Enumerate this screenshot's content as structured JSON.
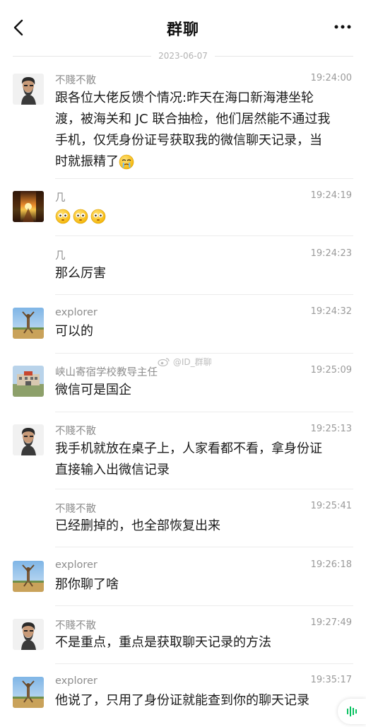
{
  "header": {
    "title": "群聊",
    "back_icon": "chevron-left-icon",
    "more_icon": "more-dots-icon"
  },
  "date_separator": "2023-06-07",
  "watermark": "@ID_群聊",
  "messages": [
    {
      "name": "不賤不散",
      "time": "19:24:00",
      "avatar": "bearded-man-avatar",
      "lines": [
        "跟各位大佬反馈个情况:昨天在海口新海港坐轮",
        "渡，被海关和 JC 联合抽检，他们居然能不通过我",
        "手机，仅凭身份证号获取我的微信聊天记录，当",
        "时就振精了"
      ]
    },
    {
      "name": "几",
      "time": "19:24:19",
      "avatar": "sunset-street-avatar",
      "emoji_count": 3
    },
    {
      "name": "几",
      "time": "19:24:23",
      "text": "那么厉害"
    },
    {
      "name": "explorer",
      "time": "19:24:32",
      "avatar": "statue-avatar",
      "text": "可以的"
    },
    {
      "name": "峡山寄宿学校教导主任",
      "time": "19:25:09",
      "avatar": "campus-avatar",
      "text": "微信可是国企"
    },
    {
      "name": "不賤不散",
      "time": "19:25:13",
      "avatar": "bearded-man-avatar",
      "lines": [
        "我手机就放在桌子上，人家看都不看，拿身份证",
        "直接输入出微信记录"
      ]
    },
    {
      "name": "不賤不散",
      "time": "19:25:41",
      "text": "已经删掉的，也全部恢复出来"
    },
    {
      "name": "explorer",
      "time": "19:26:18",
      "avatar": "statue-avatar",
      "text": "那你聊了啥"
    },
    {
      "name": "不賤不散",
      "time": "19:27:49",
      "avatar": "bearded-man-avatar",
      "text": "不是重点，重点是获取聊天记录的方法"
    },
    {
      "name": "explorer",
      "time": "19:35:17",
      "avatar": "statue-avatar",
      "text": "他说了，只用了身份证就能查到你的聊天记录"
    }
  ],
  "colors": {
    "name_gray": "#8d8d8d",
    "time_gray": "#9a9a9a",
    "divider": "#ececec",
    "accent_green": "#07c160"
  }
}
